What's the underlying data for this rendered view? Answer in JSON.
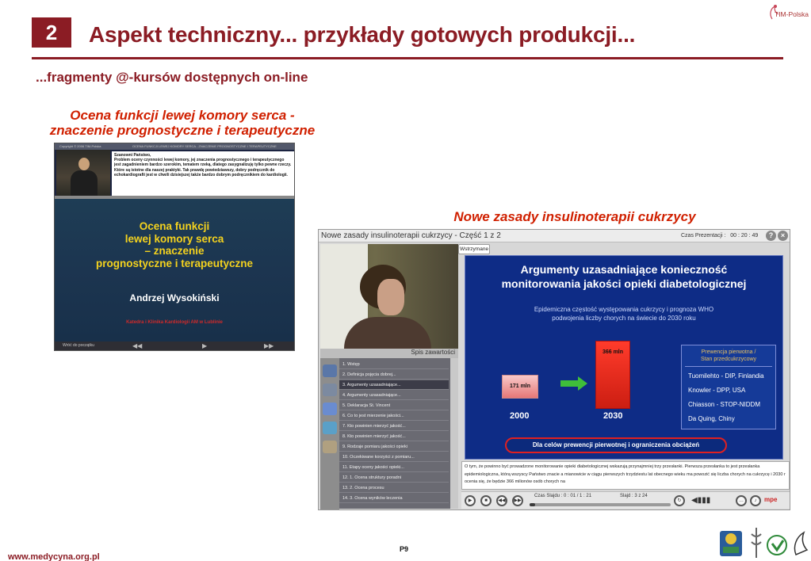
{
  "header": {
    "slide_number": "2",
    "title": "Aspekt techniczny... przykłady gotowych produkcji...",
    "brand": "TIM-Polska"
  },
  "subtitle": "...fragmenty @-kursów dostępnych on-line",
  "left": {
    "caption_line1": "Ocena funkcji lewej komory serca -",
    "caption_line2": "znaczenie prognostyczne i terapeutyczne",
    "screen": {
      "top_left": "Copyright © 2006 TIM-Polska",
      "top_right": "OCENA FUNKCJI LEWEJ KOMORY SERCA - ZNACZENIE PROGNOSTYCZNE I TERAPEUTYCZNE",
      "note_greeting": "Szanowni Państwo,",
      "note_body": "Problem oceny czynności lewej komory, jej znaczenia prognostycznego i terapeutycznego jest zagadnieniem bardzo szerokim, tematem rzeką, dlatego zasygnalizuję tylko pewne rzeczy. Które są istotne dla naszej praktyki. Tak prawdę powiedziawszy, dobry podręcznik do echokardiografii jest w chwili dzisiejszej także bardzo dobrym podręcznikiem do kardiologii.",
      "title_l1": "Ocena funkcji",
      "title_l2": "lewej komory serca",
      "title_l3": "– znaczenie",
      "title_l4": "prognostyczne i terapeutyczne",
      "author": "Andrzej Wysokiński",
      "department": "Katedra i Klinika Kardiologii AM w Lublinie",
      "back_label": "Wróć do początku"
    }
  },
  "right": {
    "caption": "Nowe zasady insulinoterapii cukrzycy",
    "screen": {
      "window_title": "Nowe zasady insulinoterapii cukrzycy  -  Część 1 z 2",
      "presentation_time_label": "Czas Prezentacji :",
      "presentation_time": "00 : 20 : 49",
      "help_icon": "?",
      "close_icon": "×",
      "stop_label": "Wstrzymane",
      "slide_title_l1": "Argumenty uzasadniające konieczność",
      "slide_title_l2": "monitorowania jakości opieki diabetologicznej",
      "slide_sub_l1": "Epidemiczna częstość występowania cukrzycy i prognoza WHO",
      "slide_sub_l2": "podwojenia liczby chorych na świecie do 2030 roku",
      "bar_2000_label": "171 mln",
      "bar_2030_label": "366 mln",
      "year_2000": "2000",
      "year_2030": "2030",
      "box_head_l1": "Prewencja pierwotna /",
      "box_head_l2": "Stan przedcukrzycowy",
      "studies": [
        "Tuomilehto - DIP, Finlandia",
        "Knowler - DPP, USA",
        "Chiasson - STOP-NIDDM",
        "Da Quing, Chiny"
      ],
      "cta": "Dla celów prewencji pierwotnej i ograniczenia obciążeń",
      "toc_title": "Spis zawartości",
      "toc_items": [
        "1. Wstęp",
        "2. Definicja pojęcia dobrej...",
        "3. Argumenty uzasadniające...",
        "4. Argumenty uzasadniające...",
        "5. Deklaracja St. Vincent",
        "6. Co to jest mierzenie jakości...",
        "7. Kto powinien mierzyć jakość...",
        "8. Kto powinien mierzyć jakość...",
        "9. Rodzaje pomiaru jakości opieki",
        "10. Oczekiwane korzyści z pomiaru...",
        "11. Etapy oceny jakości opieki...",
        "12. 1. Ocena struktury poradni",
        "13. 2. Ocena procesu",
        "14. 3. Ocena wyników leczenia"
      ],
      "toc_selected_index": 2,
      "notes": "O tym, że powinno być prowadzone monitorowanie opieki diabetologicznej wskazują przynajmniej trzy przesłanki. Pierwsza przesłanka to jest przesłanka epidemiologiczna, którą wszyscy Państwo znacie a mianowicie w ciągu pierwszych trzydziestu lat obecnego wieku ma powozić się liczba chorych na cukrzycę i 2030 r ocenia się, że będzie 366 milionów osób chorych na",
      "slide_time_label": "Czas Slajdu : 0 : 01 / 1 : 21",
      "slide_counter": "Slajd :  3 z 24",
      "progress_fraction": 0.04
    }
  },
  "footer": {
    "page": "P9",
    "url": "www.medycyna.org.pl"
  },
  "colors": {
    "brand": "#8b1c24",
    "caption": "#d02000",
    "slide_bg": "#0e2c86"
  }
}
